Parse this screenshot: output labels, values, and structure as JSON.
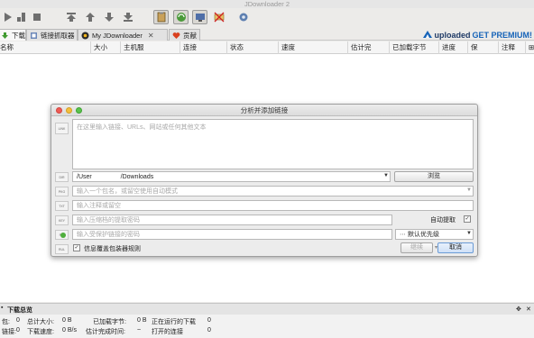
{
  "window": {
    "title": "JDownloader 2"
  },
  "tabs": [
    {
      "label": "下载"
    },
    {
      "label": "链接抓取器"
    },
    {
      "label": "My JDownloader"
    },
    {
      "label": "贡献"
    }
  ],
  "brand": {
    "part1": "uploaded",
    "part2": "GET PREMIUM!"
  },
  "columns": [
    "名称",
    "大小",
    "主机服",
    "连接",
    "状态",
    "速度",
    "估计完",
    "已加载字节",
    "进度",
    "保",
    "注释"
  ],
  "dialog": {
    "title": "分析并添加链接",
    "links_placeholder": "在这里输入链接、URLs、网站或任何其他文本",
    "folder_prefix": "/User",
    "folder_suffix": "/Downloads",
    "browse_label": "浏览",
    "package_placeholder": "输入一个包名，或留空使用自动模式",
    "comment_placeholder": "输入注释或留空",
    "archive_pw_placeholder": "输入压缩档的提取密码",
    "auto_extract_label": "自动提取",
    "download_pw_placeholder": "输入受保护链接的密码",
    "priority_label": "默认优先级",
    "overwrite_rules_label": "信息覆盖包装器规则",
    "continue_label": "继续",
    "cancel_label": "取消"
  },
  "summary": {
    "title": "下载总览",
    "packages_label": "包:",
    "packages_value": "0",
    "total_size_label": "总计大小:",
    "total_size_value": "0 B",
    "loaded_label": "已加载字节:",
    "loaded_value": "0 B",
    "running_label": "正在运行的下载",
    "running_value": "0",
    "links_label": "链接:",
    "links_value": "0",
    "speed_label": "下载速度:",
    "speed_value": "0 B/s",
    "eta_label": "估计完成时间:",
    "eta_value": "~",
    "open_conn_label": "打开的连接",
    "open_conn_value": "0"
  }
}
